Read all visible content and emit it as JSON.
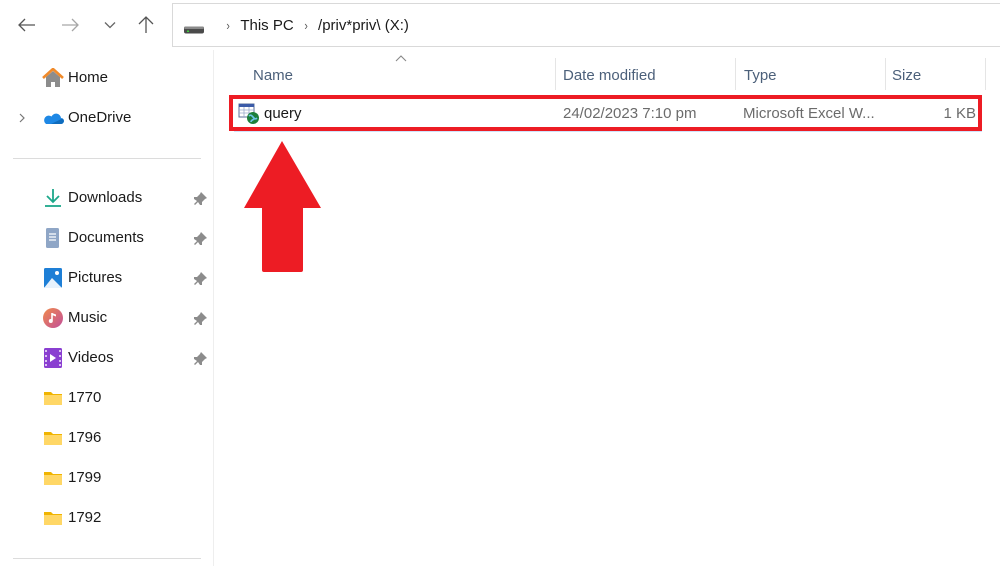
{
  "nav": {
    "back_icon": "arrow-left-icon",
    "forward_icon": "arrow-right-icon",
    "recent_icon": "chevron-down-icon",
    "up_icon": "arrow-up-icon"
  },
  "address_bar": {
    "drive_icon": "drive-icon",
    "breadcrumbs": [
      {
        "label": "This PC"
      },
      {
        "label": "/priv*priv\\ (X:)"
      }
    ]
  },
  "sidebar": {
    "top_items": [
      {
        "label": "Home",
        "icon": "home-icon",
        "expandable": false
      },
      {
        "label": "OneDrive",
        "icon": "onedrive-icon",
        "expandable": true
      }
    ],
    "quick_access": [
      {
        "label": "Downloads",
        "icon": "download-icon",
        "pinned": true
      },
      {
        "label": "Documents",
        "icon": "document-icon",
        "pinned": true
      },
      {
        "label": "Pictures",
        "icon": "pictures-icon",
        "pinned": true
      },
      {
        "label": "Music",
        "icon": "music-icon",
        "pinned": true
      },
      {
        "label": "Videos",
        "icon": "video-icon",
        "pinned": true
      },
      {
        "label": "1770",
        "icon": "folder-icon",
        "pinned": false
      },
      {
        "label": "1796",
        "icon": "folder-icon",
        "pinned": false
      },
      {
        "label": "1799",
        "icon": "folder-icon",
        "pinned": false
      },
      {
        "label": "1792",
        "icon": "folder-icon",
        "pinned": false
      }
    ]
  },
  "file_list": {
    "columns": [
      {
        "label": "Name",
        "sorted": "ascending"
      },
      {
        "label": "Date modified"
      },
      {
        "label": "Type"
      },
      {
        "label": "Size"
      }
    ],
    "rows": [
      {
        "name": "query",
        "icon": "web-query-file-icon",
        "date_modified": "24/02/2023 7:10 pm",
        "type": "Microsoft Excel W...",
        "size": "1 KB"
      }
    ]
  },
  "annotation": {
    "highlight_color": "#ed1c24",
    "arrow_color": "#ed1c24",
    "target": "query"
  }
}
